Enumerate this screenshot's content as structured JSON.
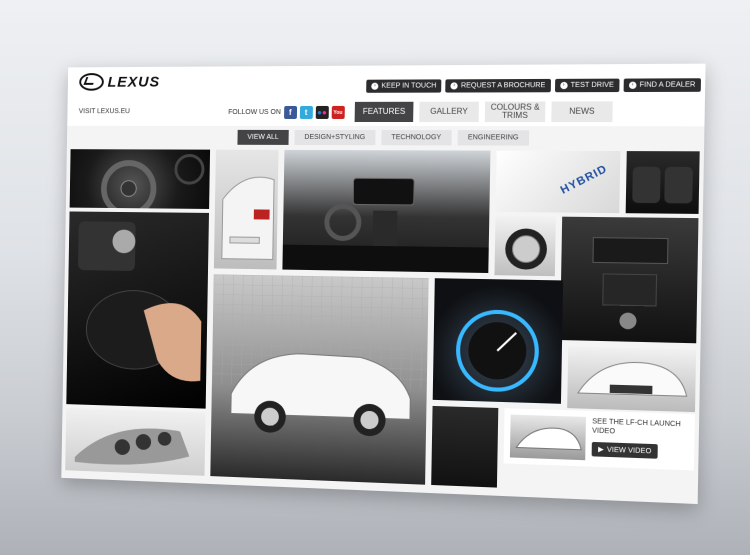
{
  "brand": {
    "logo_text": "LEXUS"
  },
  "header": {
    "visit_link": "VISIT LEXUS.EU",
    "follow_label": "FOLLOW US ON",
    "top_buttons": [
      "KEEP IN TOUCH",
      "REQUEST A BROCHURE",
      "TEST DRIVE",
      "FIND A DEALER"
    ],
    "social": [
      "f",
      "t",
      "••",
      "You"
    ]
  },
  "nav": {
    "items": [
      "FEATURES",
      "GALLERY",
      "COLOURS & TRIMS",
      "NEWS"
    ],
    "active": "FEATURES"
  },
  "subnav": {
    "items": [
      "VIEW ALL",
      "DESIGN+STYLING",
      "TECHNOLOGY",
      "ENGINEERING"
    ],
    "active": "VIEW ALL"
  },
  "promo": {
    "title": "SEE THE LF-CH LAUNCH VIDEO",
    "button": "VIEW VIDEO"
  },
  "images": {
    "hybrid_badge": "HYBRID"
  },
  "colors": {
    "dark_button": "#2c2c2e",
    "nav_active": "#444447",
    "facebook": "#3b5998",
    "twitter": "#33aadd",
    "youtube": "#cc2222"
  }
}
